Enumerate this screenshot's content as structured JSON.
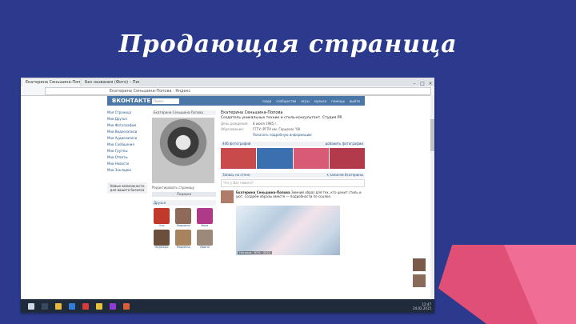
{
  "slide": {
    "title": "Продающая страница"
  },
  "browser": {
    "tabs": [
      {
        "label": "Екатерина Сеньшина-Поп…"
      },
      {
        "label": "Без названия (Фото) – Пинт…"
      }
    ],
    "window_buttons": [
      "–",
      "□",
      "×"
    ],
    "address": "Екатерина Сеньшина-Попова · Яндекс"
  },
  "vk": {
    "logo": "ВКОНТАКТЕ",
    "search_placeholder": "Поиск",
    "nav": [
      "люди",
      "сообщества",
      "игры",
      "музыка",
      "помощь",
      "выйти"
    ],
    "sidebar": [
      "Моя Страница",
      "Мои Друзья",
      "Мои Фотографии",
      "Мои Видеозаписи",
      "Мои Аудиозаписи",
      "Мои Сообщения",
      "Мои Группы",
      "Мои Ответы",
      "Мои Новости",
      "Мои Закладки"
    ],
    "sidebar_promo": "Новые возможности для вашего бизнеса",
    "profile_name_bar": "Екатерина Сеньшина-Попова",
    "profile_caption": "Редактировать страницу",
    "gifts_button": "Подарки",
    "friends_title": "Друзья",
    "friends": [
      {
        "name": "Оля"
      },
      {
        "name": "Людмила"
      },
      {
        "name": "Вера"
      },
      {
        "name": "Надежда"
      },
      {
        "name": "Людмила"
      },
      {
        "name": "Ирина"
      }
    ],
    "main": {
      "name": "Екатерина Сеньшина-Попова",
      "status": "Создатель уникальных техник и стиль-консультант. Студия PR",
      "info": [
        {
          "k": "День рождения:",
          "v": "8 июля 1985 г."
        },
        {
          "k": "Образование:",
          "v": "ГГГУ (РГПУ им. Герцена) '08"
        }
      ],
      "more_info": "Показать подробную информацию",
      "photos_label": "446 фотографий",
      "photos_link": "добавить фотографии",
      "wall_label": "Запись на стене",
      "wall_link": "к записям Екатерины",
      "post_placeholder": "Что у Вас нового?",
      "post_author": "Екатерина Сеньшина-Попова",
      "post_text": "Зимний образ для тех, кто ценит стиль и уют. Создаём образы вместе — подробности по ссылке.",
      "post_image_caption": "Наталья · 87% · 2015"
    }
  },
  "colors": {
    "slide_bg": "#2b3a8c",
    "vk_blue": "#4a76a8",
    "accent_pink": "#e04f76",
    "accent_pink_light": "#f06d95"
  },
  "taskbar": {
    "clock_time": "12:47",
    "clock_date": "24.02.2015"
  }
}
